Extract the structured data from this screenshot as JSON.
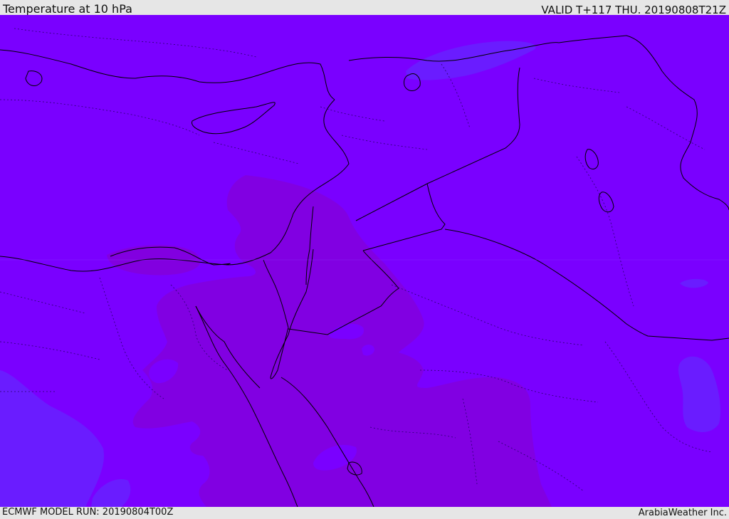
{
  "header": {
    "title": "Temperature at 10 hPa",
    "valid_time": "VALID T+117 THU. 20190808T21Z"
  },
  "footer": {
    "model_run": "ECMWF MODEL RUN: 20190804T00Z",
    "credit": "ArabiaWeather Inc."
  },
  "map": {
    "variable": "temperature",
    "pressure_level": "10 hPa",
    "colors": {
      "base_field": "#7a00ff",
      "warm_band": "#8200e0",
      "cool_band": "#6a1cff",
      "coastline": "#000000",
      "border_dotted": "#2a0070"
    }
  }
}
